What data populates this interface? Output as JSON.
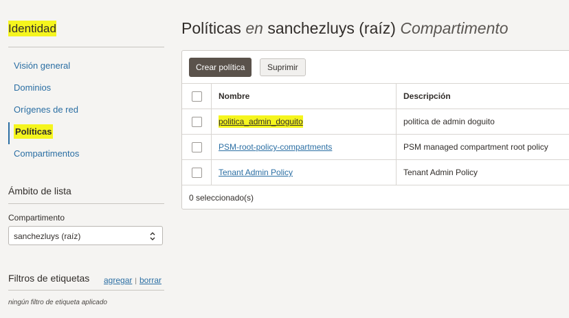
{
  "sidebar": {
    "title": "Identidad",
    "nav": [
      {
        "label": "Visión general"
      },
      {
        "label": "Dominios"
      },
      {
        "label": "Orígenes de red"
      },
      {
        "label": "Políticas"
      },
      {
        "label": "Compartimentos"
      }
    ],
    "active_index": 3,
    "scope_title": "Ámbito de lista",
    "compartment_label": "Compartimento",
    "compartment_value": "sanchezluys (raíz)",
    "tag_filters_title": "Filtros de etiquetas",
    "tag_add": "agregar",
    "tag_sep": "|",
    "tag_clear": "borrar",
    "no_filter": "ningún filtro de etiqueta aplicado"
  },
  "header": {
    "title_main": "Políticas",
    "title_conj": "en",
    "title_scope": "sanchezluys (raíz)",
    "title_kind": "Compartimento"
  },
  "toolbar": {
    "create_label": "Crear política",
    "delete_label": "Suprimir"
  },
  "table": {
    "columns": [
      "Nombre",
      "Descripción"
    ],
    "rows": [
      {
        "name": "politica_admin_doguito",
        "description": "politica de admin doguito"
      },
      {
        "name": "PSM-root-policy-compartments",
        "description": "PSM managed compartment root policy"
      },
      {
        "name": "Tenant Admin Policy",
        "description": "Tenant Admin Policy"
      }
    ],
    "selected_text": "0 seleccionado(s)"
  },
  "colors": {
    "highlight": "#f5f51e",
    "link": "#2a6ea3",
    "primary_button": "#5a524b"
  }
}
